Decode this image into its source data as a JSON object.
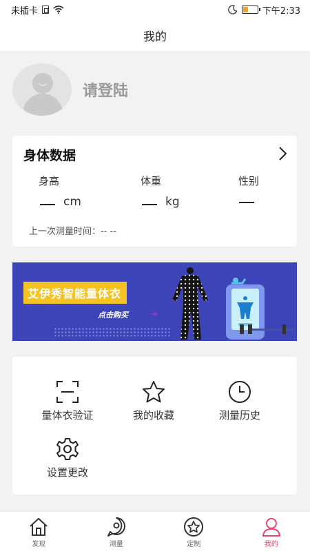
{
  "status_bar": {
    "carrier": "未插卡",
    "time": "下午2:33",
    "battery_color": "#f3a01b"
  },
  "header": {
    "title": "我的"
  },
  "profile": {
    "login_text": "请登陆",
    "avatar_icon": "user-avatar-placeholder"
  },
  "body_data": {
    "title": "身体数据",
    "columns": [
      {
        "label": "身高",
        "value": "__",
        "unit": "cm"
      },
      {
        "label": "体重",
        "value": "__",
        "unit": "kg"
      },
      {
        "label": "性别",
        "value": "__",
        "unit": ""
      }
    ],
    "last_measure": "上一次测量时间：-- --"
  },
  "banner": {
    "title": "艾伊秀智能量体衣",
    "buy_text": "点击购买",
    "accent_color": "#f6c324",
    "background_color": "#3d44b8"
  },
  "menu": {
    "items": [
      {
        "label": "量体衣验证",
        "icon": "scan-icon"
      },
      {
        "label": "我的收藏",
        "icon": "star-icon"
      },
      {
        "label": "测量历史",
        "icon": "clock-icon"
      },
      {
        "label": "设置更改",
        "icon": "gear-icon"
      }
    ]
  },
  "tabs": {
    "active_color": "#e8446c",
    "items": [
      {
        "label": "发现",
        "icon": "home-icon"
      },
      {
        "label": "测量",
        "icon": "measure-icon"
      },
      {
        "label": "定制",
        "icon": "custom-star-icon"
      },
      {
        "label": "我的",
        "icon": "profile-icon",
        "active": true
      }
    ]
  }
}
